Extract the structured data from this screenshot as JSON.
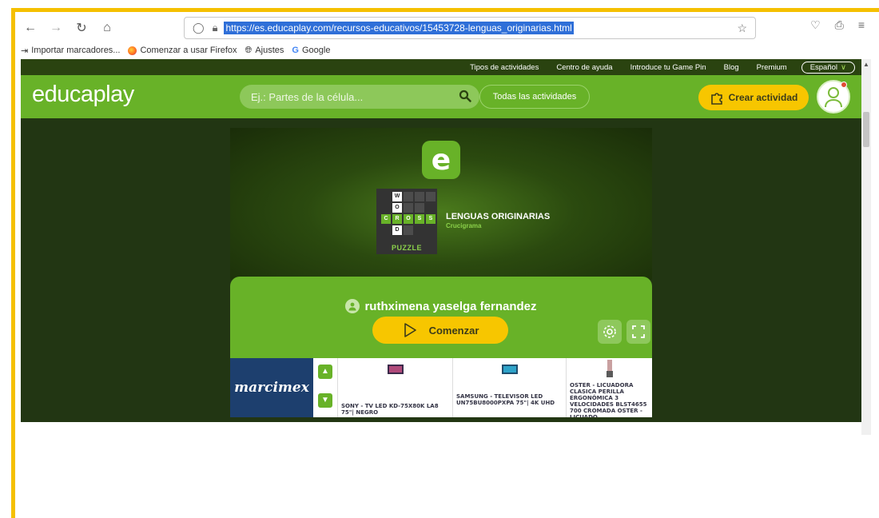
{
  "browser": {
    "url": "https://es.educaplay.com/recursos-educativos/15453728-lenguas_originarias.html",
    "bookmarks": [
      {
        "label": "Importar marcadores...",
        "icon": "import-icon"
      },
      {
        "label": "Comenzar a usar Firefox",
        "icon": "firefox-icon"
      },
      {
        "label": "Ajustes",
        "icon": "globe-icon"
      },
      {
        "label": "Google",
        "icon": "google-icon"
      }
    ]
  },
  "topnav": {
    "items": [
      "Tipos de actividades",
      "Centro de ayuda",
      "Introduce tu Game Pin",
      "Blog",
      "Premium"
    ],
    "language": "Español"
  },
  "header": {
    "logo_bold": "educa",
    "logo_light": "play",
    "search_placeholder": "Ej.: Partes de la célula...",
    "all_activities": "Todas las actividades",
    "create_label": "Crear actividad"
  },
  "activity": {
    "badge_letter": "e",
    "puzzle_label": "PUZZLE",
    "title": "LENGUAS ORIGINARIAS",
    "type": "Crucigrama",
    "author": "ruthximena yaselga fernandez",
    "start_label": "Comenzar"
  },
  "ad": {
    "brand": "marcimex",
    "products": [
      "SONY - TV LED KD-75X80K LA8 75\"| NEGRO",
      "SAMSUNG - TELEVISOR LED UN75BU8000PXPA 75\"| 4K UHD",
      "OSTER - LICUADORA CLASICA PERILLA ERGONÓMICA 3 VELOCIDADES BLST4655 700 CROMADA OSTER - LICUADO"
    ]
  },
  "colors": {
    "brand_green": "#68b228",
    "dark_green": "#223613",
    "accent_yellow": "#f7c600",
    "frame_yellow": "#f5c000"
  }
}
